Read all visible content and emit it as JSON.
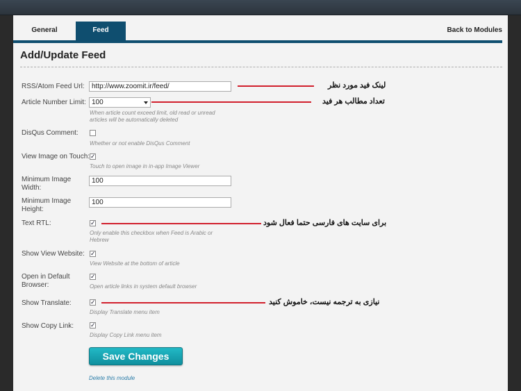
{
  "tabs": {
    "general": "General",
    "feed": "Feed",
    "back": "Back to Modules"
  },
  "page_title": "Add/Update Feed",
  "fields": {
    "rss_url": {
      "label": "RSS/Atom Feed Url:",
      "value": "http://www.zoomit.ir/feed/"
    },
    "article_limit": {
      "label": "Article Number Limit:",
      "value": "100",
      "hint": "When article count exceed limit, old read or unread articles will be automatically deleted"
    },
    "disqus": {
      "label": "DisQus Comment:",
      "checked": false,
      "hint": "Whether or not enable DisQus Comment"
    },
    "view_image": {
      "label": "View Image on Touch:",
      "checked": true,
      "hint": "Touch to open image in in-app Image Viewer"
    },
    "min_width": {
      "label": "Minimum Image Width:",
      "value": "100"
    },
    "min_height": {
      "label": "Minimum Image Height:",
      "value": "100"
    },
    "text_rtl": {
      "label": "Text RTL:",
      "checked": true,
      "hint": "Only enable this checkbox when Feed is Arabic or Hebrew"
    },
    "show_view_website": {
      "label": "Show View Website:",
      "checked": true,
      "hint": "View Website at the bottom of article"
    },
    "open_default_browser": {
      "label": "Open in Default Browser:",
      "checked": true,
      "hint": "Open article links in system default browser"
    },
    "show_translate": {
      "label": "Show Translate:",
      "checked": true,
      "hint": "Display Translate menu item"
    },
    "show_copy_link": {
      "label": "Show Copy Link:",
      "checked": true,
      "hint": "Display Copy Link menu item"
    }
  },
  "save_button": "Save Changes",
  "delete_link": "Delete this module",
  "annotations": {
    "feed_url": "لینک فید مورد نظر",
    "article_count": "تعداد مطالب هر فید",
    "rtl": "برای سایت های فارسی حتما فعال شود",
    "translate": "نیازی به ترجمه نیست، خاموش کنید"
  },
  "colors": {
    "accent": "#0f4e6f",
    "button": "#16a8b6",
    "annotation_line": "#d11f2c"
  }
}
